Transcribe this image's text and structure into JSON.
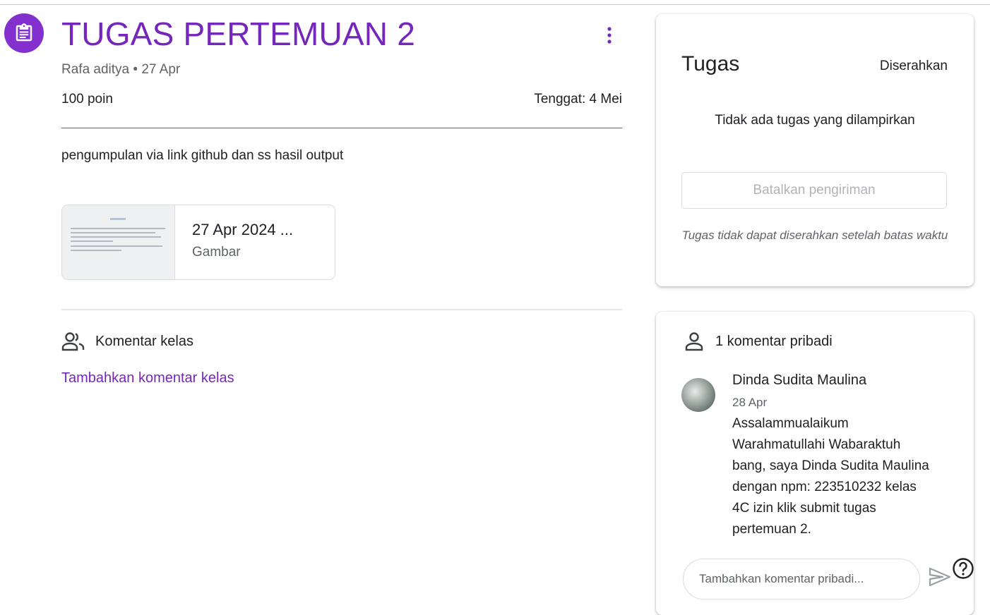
{
  "assignment": {
    "title": "TUGAS PERTEMUAN 2",
    "meta": "Rafa aditya • 27 Apr",
    "points": "100 poin",
    "due": "Tenggat: 4 Mei",
    "description": "pengumpulan via link github dan ss hasil output",
    "attachment": {
      "name": "27 Apr 2024 ...",
      "type": "Gambar",
      "thumbnail_heading": "TUGAS"
    },
    "icon": "assignment-icon",
    "menu_icon": "more-vert-icon"
  },
  "class_comments": {
    "icon": "people-icon",
    "label": "Komentar kelas",
    "add_link": "Tambahkan komentar kelas"
  },
  "your_work": {
    "title": "Tugas",
    "status": "Diserahkan",
    "empty_text": "Tidak ada tugas yang dilampirkan",
    "unsubmit_label": "Batalkan pengiriman",
    "late_note": "Tugas tidak dapat diserahkan setelah batas waktu"
  },
  "private_comments": {
    "icon": "person-icon",
    "header": "1 komentar pribadi",
    "comments": [
      {
        "author": "Dinda Sudita Maulina",
        "date": "28 Apr",
        "text": "Assalammualaikum Warahmatullahi Wabaraktuh bang, saya Dinda Sudita Maulina dengan npm: 223510232 kelas 4C izin klik submit tugas pertemuan 2."
      }
    ],
    "input_placeholder": "Tambahkan komentar pribadi...",
    "send_icon": "send-icon"
  },
  "help_icon": "help-icon",
  "colors": {
    "accent": "#7627bb",
    "icon_bg": "#8430ce",
    "divider": "#8e3aa8",
    "text": "#202124",
    "muted": "#5f6368"
  }
}
